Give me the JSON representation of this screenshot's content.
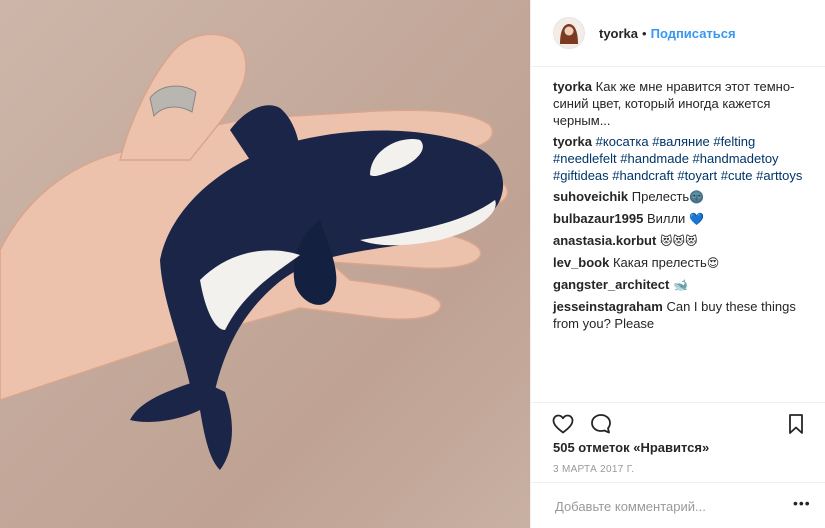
{
  "post": {
    "author": "tyorka",
    "follow_label": "Подписаться",
    "separator": "•",
    "caption": "Как же мне нравится этот темно-синий цвет, который иногда кажется черным...",
    "hashtags": [
      "#косатка",
      "#валяние",
      "#felting",
      "#needlefelt",
      "#handmade",
      "#handmadetoy",
      "#giftideas",
      "#handcraft",
      "#toyart",
      "#cute",
      "#arttoys"
    ],
    "comments": [
      {
        "user": "suhoveichik",
        "text": "Прелесть",
        "emoji": "🌚"
      },
      {
        "user": "bulbazaur1995",
        "text": "Вилли",
        "emoji": "💙"
      },
      {
        "user": "anastasia.korbut",
        "text": "",
        "emoji": "😻😻😻"
      },
      {
        "user": "lev_book",
        "text": "Какая прелесть",
        "emoji": "😍"
      },
      {
        "user": "gangster_architect",
        "text": "",
        "emoji": "🐋"
      },
      {
        "user": "jesseinstagraham",
        "text": "Can I buy these things from you? Please",
        "emoji": ""
      }
    ],
    "likes": "505 отметок «Нравится»",
    "date": "3 МАРТА 2017 Г.",
    "add_comment_placeholder": "Добавьте комментарий...",
    "more_label": "•••"
  },
  "icons": {
    "like": "heart-outline-icon",
    "comment": "speech-bubble-icon",
    "save": "bookmark-icon",
    "more": "ellipsis-icon"
  },
  "colors": {
    "link_blue": "#3897f0",
    "hashtag_blue": "#003569",
    "text": "#262626",
    "muted": "#999999",
    "orca_navy": "#1a2547",
    "photo_background": "#c4aa9c"
  }
}
